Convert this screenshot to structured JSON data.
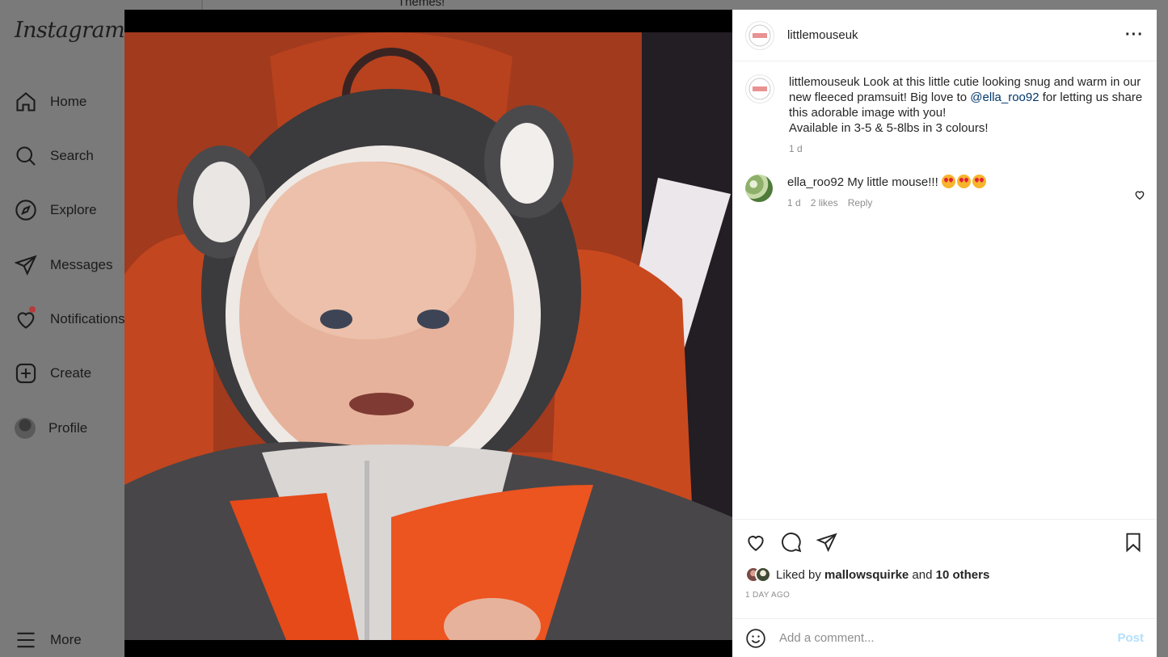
{
  "app": {
    "logo_text": "Instagram"
  },
  "background": {
    "partial_heading": "Themes!"
  },
  "sidebar": {
    "items": [
      {
        "label": "Home",
        "icon": "home-icon"
      },
      {
        "label": "Search",
        "icon": "search-icon"
      },
      {
        "label": "Explore",
        "icon": "compass-icon"
      },
      {
        "label": "Messages",
        "icon": "send-icon"
      },
      {
        "label": "Notifications",
        "icon": "heart-icon",
        "has_badge": true
      },
      {
        "label": "Create",
        "icon": "plus-square-icon"
      },
      {
        "label": "Profile",
        "icon": "avatar"
      },
      {
        "label": "More",
        "icon": "hamburger-icon"
      }
    ]
  },
  "post": {
    "author": "littlemouseuk",
    "caption": {
      "username": "littlemouseuk",
      "text_before_mention": " Look at this little cutie looking snug and warm in our new fleeced pramsuit! Big love to ",
      "mention": "@ella_roo92",
      "text_after_mention": " for letting us share this adorable image with you!",
      "line2": "Available in 3-5 & 5-8lbs in 3 colours!",
      "time": "1 d"
    },
    "comments": [
      {
        "username": "ella_roo92",
        "text": "My little mouse!!!",
        "emoji_count": 3,
        "time": "1 d",
        "likes": "2 likes",
        "reply_label": "Reply"
      }
    ],
    "likes": {
      "prefix": "Liked by ",
      "user": "mallowsquirke",
      "middle": " and ",
      "others": "10 others"
    },
    "timestamp": "1 DAY AGO",
    "comment_input": {
      "placeholder": "Add a comment...",
      "post_label": "Post"
    }
  },
  "colors": {
    "mention": "#00376b",
    "post_disabled": "#b2dffc",
    "notification_badge": "#ff3040"
  }
}
